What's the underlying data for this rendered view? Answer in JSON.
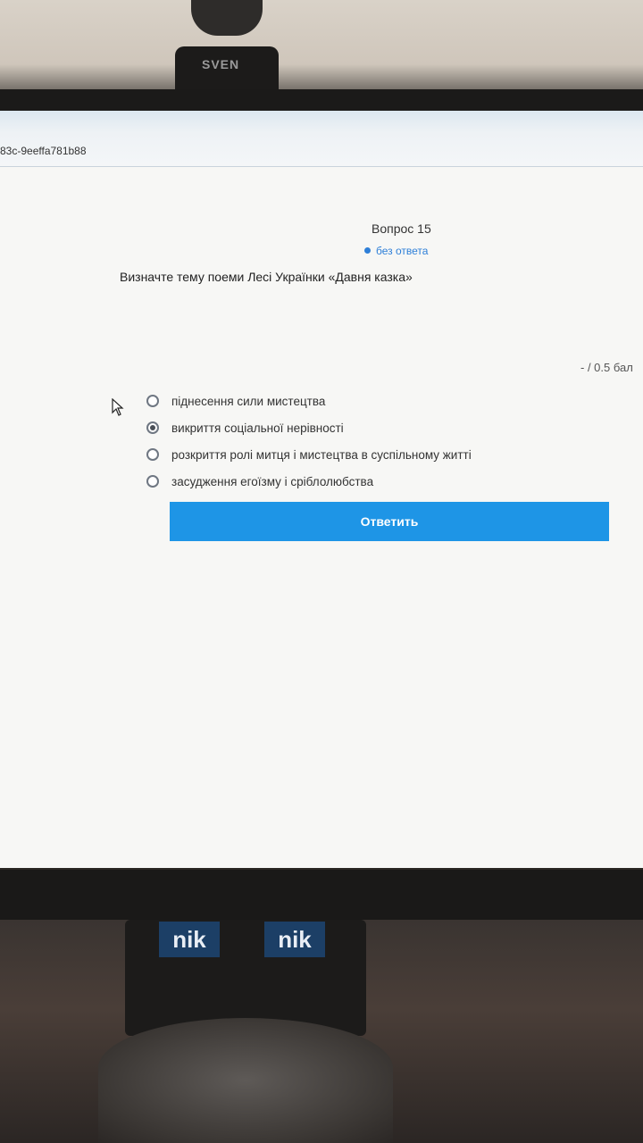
{
  "browser": {
    "url_fragment": "83c-9eeffa781b88"
  },
  "webcam": {
    "brand": "SVEN"
  },
  "quiz": {
    "question_label": "Вопрос 15",
    "status": "без ответа",
    "prompt": "Визначте тему поеми Лесі Українки «Давня казка»",
    "score": "- / 0.5 бал",
    "options": [
      {
        "label": "піднесення сили мистецтва",
        "checked": false
      },
      {
        "label": "викриття соціальної нерівності",
        "checked": true
      },
      {
        "label": "розкриття ролі митця і мистецтва в суспільному житті",
        "checked": false
      },
      {
        "label": "засудження егоїзму і сріблолюбства",
        "checked": false
      }
    ],
    "submit_label": "Ответить"
  },
  "stickers": [
    "nik",
    "nik"
  ],
  "colors": {
    "accent": "#1e95e6",
    "status": "#2e7fd8"
  },
  "icons": {
    "taskbar": [
      "warning-triangle-icon",
      "viber-icon",
      "onedrive-cloud-icon"
    ],
    "cursor": "mouse-pointer-icon"
  }
}
